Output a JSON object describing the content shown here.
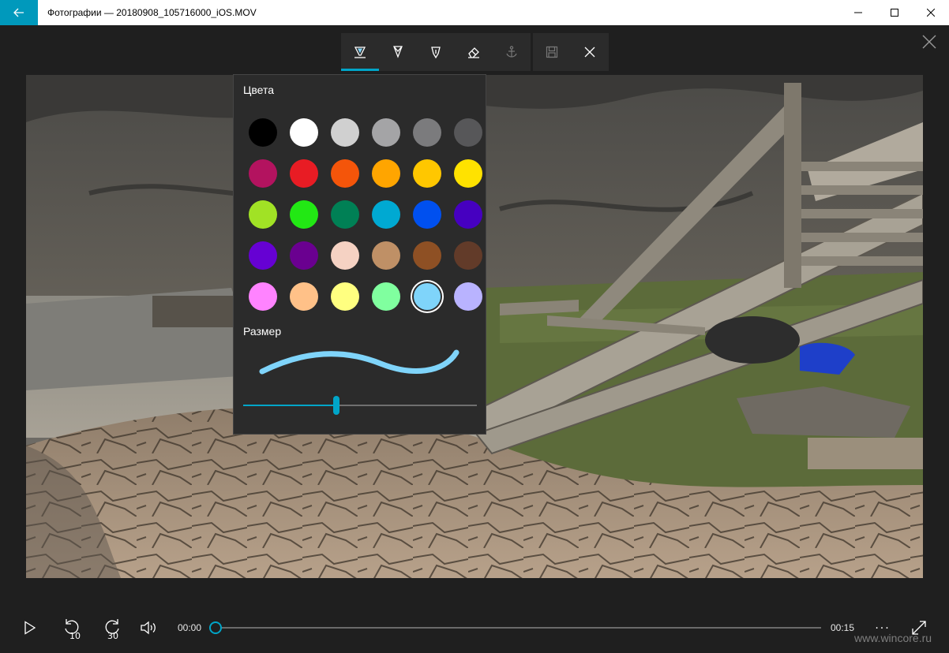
{
  "window": {
    "title": "Фотографии — 20180908_105716000_iOS.MOV",
    "back_icon": "back-arrow-icon",
    "accent": "#0099bc"
  },
  "ink_toolbar": {
    "tools": [
      {
        "name": "ballpoint-pen",
        "icon": "ballpoint-pen-icon",
        "active": true
      },
      {
        "name": "pencil",
        "icon": "pencil-icon",
        "active": false
      },
      {
        "name": "calligraphy-pen",
        "icon": "calligraphy-pen-icon",
        "active": false
      },
      {
        "name": "eraser",
        "icon": "eraser-icon",
        "active": false
      },
      {
        "name": "anchor",
        "icon": "anchor-icon",
        "active": false
      }
    ],
    "actions": [
      {
        "name": "save",
        "icon": "save-icon"
      },
      {
        "name": "close",
        "icon": "close-icon"
      }
    ],
    "active_color": "#00a5c8"
  },
  "color_flyout": {
    "colors_heading": "Цвета",
    "size_heading": "Размер",
    "selected_color": "#7fd4fa",
    "colors": [
      "#000000",
      "#ffffff",
      "#d0d0d0",
      "#a4a4a6",
      "#7b7b7d",
      "#575759",
      "#b3135f",
      "#e81c24",
      "#f4550a",
      "#ffa500",
      "#ffc700",
      "#ffe200",
      "#a1e225",
      "#22e814",
      "#008055",
      "#00a9d2",
      "#0050ef",
      "#4600c0",
      "#6601d3",
      "#6a0090",
      "#f5d2c3",
      "#bf9066",
      "#8e5024",
      "#623b29",
      "#ff83ff",
      "#ffc188",
      "#ffff80",
      "#80ff9f",
      "#7fd4fa",
      "#b9b3ff"
    ],
    "size_percent": 40
  },
  "playback": {
    "current_time": "00:00",
    "total_time": "00:15",
    "progress_percent": 0,
    "skip_back_label": "10",
    "skip_forward_label": "30",
    "more_label": "...",
    "icons": {
      "play": "play-icon",
      "skip_back": "skip-back-icon",
      "skip_forward": "skip-forward-icon",
      "volume": "volume-icon",
      "more": "more-icon",
      "fullscreen": "fullscreen-icon"
    }
  },
  "watermark": "www.wincore.ru"
}
